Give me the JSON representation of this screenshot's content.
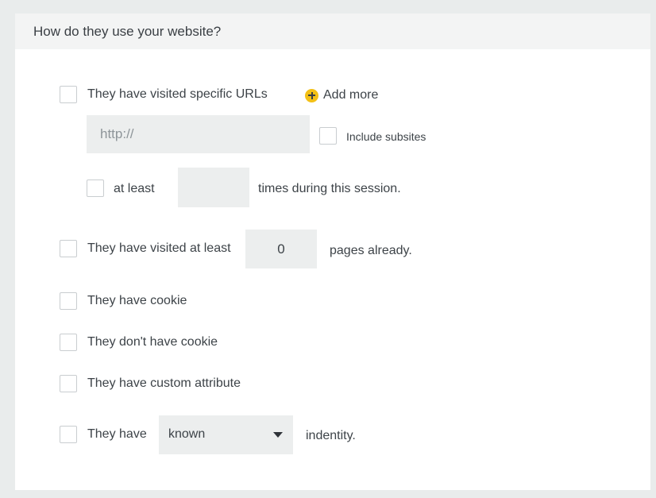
{
  "section": {
    "title": "How do they use your website?"
  },
  "urls": {
    "label": "They have visited specific URLs",
    "add_more": "Add more",
    "url_placeholder": "http://",
    "include_subsites": "Include subsites",
    "at_least": "at least",
    "times_value": "",
    "times_suffix": "times during this session."
  },
  "pages": {
    "label": "They have visited at least",
    "value": "0",
    "suffix": "pages already."
  },
  "cookie": {
    "has_label": "They have cookie",
    "not_label": "They don't have cookie"
  },
  "custom_attribute": {
    "label": "They have custom attribute"
  },
  "identity": {
    "prefix": "They have",
    "selected": "known",
    "suffix": "indentity."
  }
}
